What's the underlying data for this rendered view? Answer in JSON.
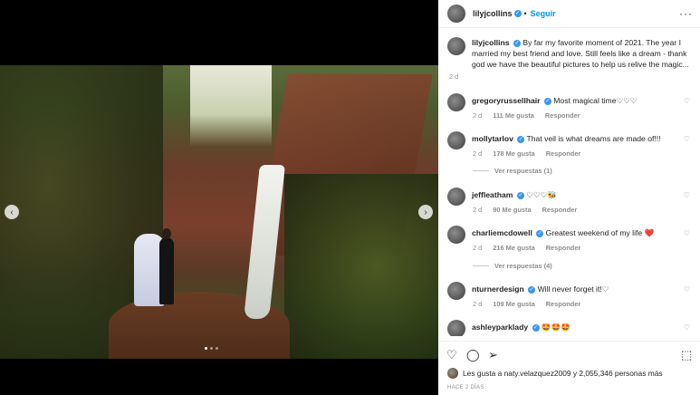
{
  "post": {
    "author": "lilyjcollins",
    "follow_label": "Seguir",
    "more_label": "···",
    "caption": "By far my favorite moment of 2021. The year I married my best friend and love. Still feels like a dream - thank god we have the beautiful pictures to help us relive the magic...",
    "caption_age": "2 d"
  },
  "media": {
    "prev_label": "‹",
    "next_label": "›",
    "active_slide": 1,
    "total_slides": 3
  },
  "comments": [
    {
      "user": "gregoryrussellhair",
      "verified": true,
      "text": "Most magical time♡♡♡",
      "age": "2 d",
      "likes": "111 Me gusta",
      "reply": "Responder"
    },
    {
      "user": "mollytarlov",
      "verified": true,
      "text": "That veil is what dreams are made of!!!",
      "age": "2 d",
      "likes": "178 Me gusta",
      "reply": "Responder",
      "view_replies": "Ver respuestas (1)"
    },
    {
      "user": "jeffleatham",
      "verified": true,
      "text": "♡♡♡🐝",
      "age": "2 d",
      "likes": "90 Me gusta",
      "reply": "Responder"
    },
    {
      "user": "charliemcdowell",
      "verified": true,
      "text": "Greatest weekend of my life ❤️",
      "age": "2 d",
      "likes": "216 Me gusta",
      "reply": "Responder",
      "view_replies": "Ver respuestas (4)"
    },
    {
      "user": "nturnerdesign",
      "verified": true,
      "text": "Will never forget it!♡",
      "age": "2 d",
      "likes": "109 Me gusta",
      "reply": "Responder"
    },
    {
      "user": "ashleyparklady",
      "verified": true,
      "text": "🤩🤩🤩",
      "age": "",
      "likes": "",
      "reply": ""
    }
  ],
  "footer": {
    "likes_text": "Les gusta a naty.velazquez2009 y 2,055,346 personas más",
    "timestamp": "HACE 2 DÍAS"
  },
  "icons": {
    "heart": "♡",
    "comment": "◯",
    "share": "➢",
    "save": "⬚",
    "verified": "✓"
  },
  "colors": {
    "accent": "#0095f6",
    "verified": "#3897f0",
    "muted": "#8e8e8e"
  }
}
